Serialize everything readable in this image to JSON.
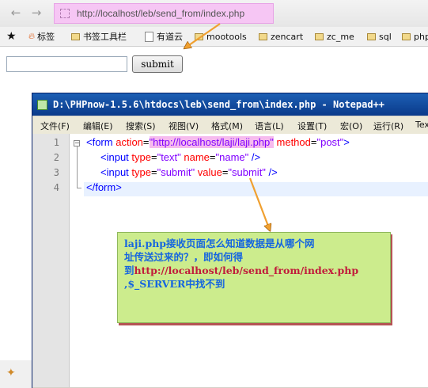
{
  "browser": {
    "back_glyph": "◀",
    "forward_glyph": "➔",
    "address": "http://localhost/leb/send_from/index.php",
    "bookmarks": [
      {
        "icon": "star-icon",
        "label": ""
      },
      {
        "icon": "fire-icon",
        "label": "标签"
      },
      {
        "icon": "folder-icon",
        "label": "书签工具栏"
      },
      {
        "icon": "page-icon",
        "label": "有道云"
      },
      {
        "icon": "folder-icon",
        "label": "mootools"
      },
      {
        "icon": "folder-icon",
        "label": "zencart"
      },
      {
        "icon": "folder-icon",
        "label": "zc_me"
      },
      {
        "icon": "folder-icon",
        "label": "sql"
      },
      {
        "icon": "folder-icon",
        "label": "php"
      }
    ]
  },
  "page": {
    "text_input_value": "",
    "submit_label": "submit"
  },
  "notepad": {
    "title": "D:\\PHPnow-1.5.6\\htdocs\\leb\\send_from\\index.php - Notepad++",
    "menu": [
      "文件(F)",
      "编辑(E)",
      "搜索(S)",
      "视图(V)",
      "格式(M)",
      "语言(L)",
      "设置(T)",
      "宏(O)",
      "运行(R)",
      "Tex"
    ],
    "line_numbers": [
      "1",
      "2",
      "3",
      "4"
    ],
    "code": {
      "l1_open": "<form ",
      "l1_attr1": "action",
      "l1_eq1": "=",
      "l1_val1": "\"http://localhost/laji/laji.php\"",
      "l1_attr2": "method",
      "l1_eq2": "=",
      "l1_val2": "\"post\"",
      "l1_close": ">",
      "l2_open": "<input ",
      "l2_attr1": "type",
      "l2_eq1": "=",
      "l2_val1": "\"text\"",
      "l2_attr2": "name",
      "l2_eq2": "=",
      "l2_val2": "\"name\"",
      "l2_close": " />",
      "l3_open": "<input ",
      "l3_attr1": "type",
      "l3_eq1": "=",
      "l3_val1": "\"submit\"",
      "l3_attr2": "value",
      "l3_eq2": "=",
      "l3_val2": "\"submit\"",
      "l3_close": " />",
      "l4": "</form>"
    }
  },
  "note": {
    "line1": "laji.php接收页面怎么知道数据是从哪个网",
    "line2": "址传送过来的？，即如何得",
    "line3_prefix": "到",
    "line3_url": "http://localhost/leb/send_from/index.php",
    "line4": ",$_SERVER中找不到"
  },
  "colors": {
    "address_highlight": "#f6c6f4",
    "note_bg": "#ccec8d",
    "arrow": "#f0a030",
    "tag": "#0000ff",
    "attr": "#ff0000",
    "value": "#8000ff"
  }
}
